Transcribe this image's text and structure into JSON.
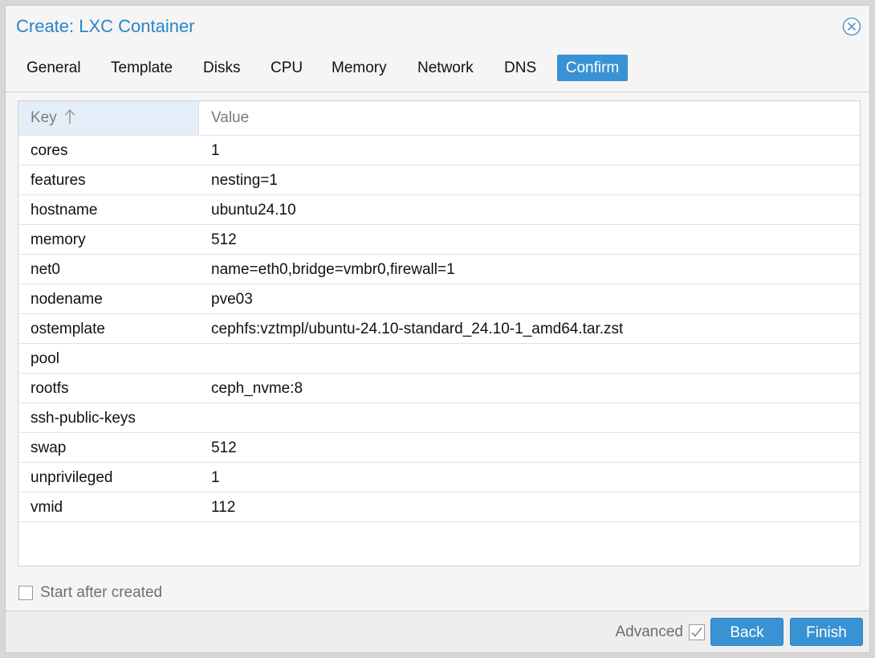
{
  "window": {
    "title": "Create: LXC Container",
    "close_icon": "close-circle-icon"
  },
  "tabs": [
    {
      "label": "General",
      "active": false
    },
    {
      "label": "Template",
      "active": false
    },
    {
      "label": "Disks",
      "active": false
    },
    {
      "label": "CPU",
      "active": false
    },
    {
      "label": "Memory",
      "active": false
    },
    {
      "label": "Network",
      "active": false
    },
    {
      "label": "DNS",
      "active": false
    },
    {
      "label": "Confirm",
      "active": true
    }
  ],
  "grid": {
    "columns": {
      "key": "Key",
      "value": "Value",
      "sort": "ascending",
      "sort_icon": "arrow-up-icon"
    },
    "rows": [
      {
        "key": "cores",
        "value": "1"
      },
      {
        "key": "features",
        "value": "nesting=1"
      },
      {
        "key": "hostname",
        "value": "ubuntu24.10"
      },
      {
        "key": "memory",
        "value": "512"
      },
      {
        "key": "net0",
        "value": "name=eth0,bridge=vmbr0,firewall=1"
      },
      {
        "key": "nodename",
        "value": "pve03"
      },
      {
        "key": "ostemplate",
        "value": "cephfs:vztmpl/ubuntu-24.10-standard_24.10-1_amd64.tar.zst"
      },
      {
        "key": "pool",
        "value": ""
      },
      {
        "key": "rootfs",
        "value": "ceph_nvme:8"
      },
      {
        "key": "ssh-public-keys",
        "value": ""
      },
      {
        "key": "swap",
        "value": "512"
      },
      {
        "key": "unprivileged",
        "value": "1"
      },
      {
        "key": "vmid",
        "value": "112"
      }
    ]
  },
  "start_after_created": {
    "label": "Start after created",
    "checked": false
  },
  "footer": {
    "advanced_label": "Advanced",
    "advanced_checked": true,
    "back_label": "Back",
    "finish_label": "Finish"
  },
  "colors": {
    "accent": "#3892d4",
    "title": "#2a86c7",
    "header_sorted_bg": "#e3eef9"
  }
}
